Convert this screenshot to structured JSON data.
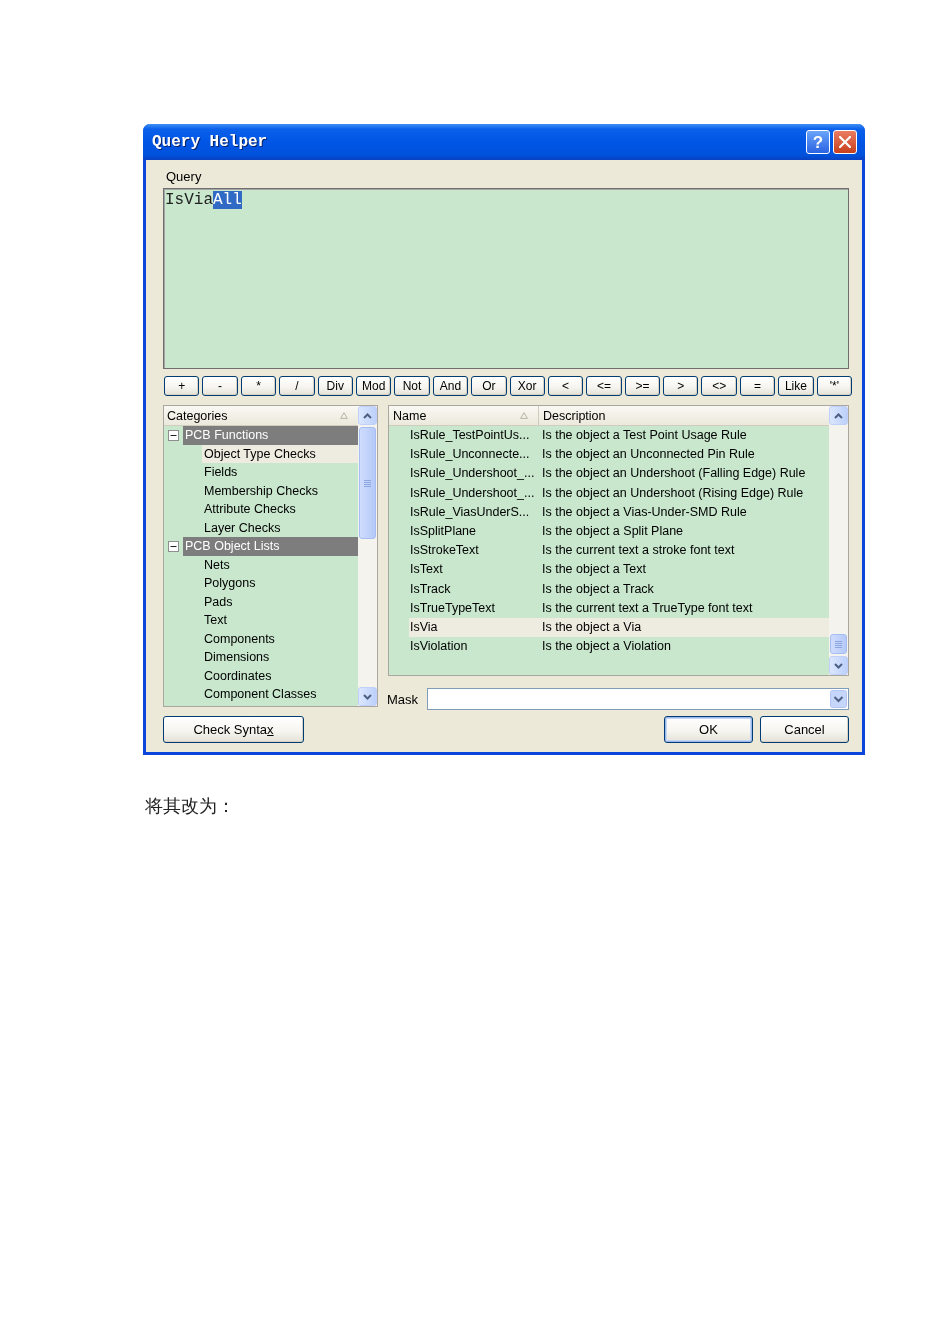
{
  "window": {
    "title": "Query Helper",
    "help_button": "?"
  },
  "query": {
    "label": "Query",
    "value_parts": [
      {
        "text": "IsVia",
        "selected": false
      },
      {
        "text": "All",
        "selected": true
      }
    ]
  },
  "operators": [
    "+",
    "-",
    "*",
    "/",
    "Div",
    "Mod",
    "Not",
    "And",
    "Or",
    "Xor",
    "<",
    "<=",
    ">=",
    ">",
    "<>",
    "=",
    "Like",
    "'*'"
  ],
  "categories": {
    "header": {
      "label": "Categories",
      "sorted": true
    },
    "items": [
      {
        "label": "PCB Functions",
        "expanded": true,
        "children": [
          {
            "label": "Object Type Checks",
            "selected": true
          },
          {
            "label": "Fields",
            "selected": false
          },
          {
            "label": "Membership Checks",
            "selected": false
          },
          {
            "label": "Attribute Checks",
            "selected": false
          },
          {
            "label": "Layer Checks",
            "selected": false
          }
        ]
      },
      {
        "label": "PCB Object Lists",
        "expanded": true,
        "children": [
          {
            "label": "Nets",
            "selected": false
          },
          {
            "label": "Polygons",
            "selected": false
          },
          {
            "label": "Pads",
            "selected": false
          },
          {
            "label": "Text",
            "selected": false
          },
          {
            "label": "Components",
            "selected": false
          },
          {
            "label": "Dimensions",
            "selected": false
          },
          {
            "label": "Coordinates",
            "selected": false
          },
          {
            "label": "Component Classes",
            "selected": false
          }
        ]
      }
    ]
  },
  "functions": {
    "columns": [
      {
        "label": "Name",
        "sorted": true
      },
      {
        "label": "Description",
        "sorted": false
      }
    ],
    "rows": [
      {
        "name": "IsRule_TestPointUs...",
        "description": "Is the object a Test Point Usage Rule",
        "selected": false
      },
      {
        "name": "IsRule_Unconnecte...",
        "description": "Is the object an Unconnected Pin Rule",
        "selected": false
      },
      {
        "name": "IsRule_Undershoot_...",
        "description": "Is the object an Undershoot (Falling Edge) Rule",
        "selected": false
      },
      {
        "name": "IsRule_Undershoot_...",
        "description": "Is the object an Undershoot (Rising Edge) Rule",
        "selected": false
      },
      {
        "name": "IsRule_ViasUnderS...",
        "description": "Is the object a Vias-Under-SMD Rule",
        "selected": false
      },
      {
        "name": "IsSplitPlane",
        "description": "Is the object a Split Plane",
        "selected": false
      },
      {
        "name": "IsStrokeText",
        "description": "Is the current text a stroke font text",
        "selected": false
      },
      {
        "name": "IsText",
        "description": "Is the object a Text",
        "selected": false
      },
      {
        "name": "IsTrack",
        "description": "Is the object a Track",
        "selected": false
      },
      {
        "name": "IsTrueTypeText",
        "description": "Is the current text a TrueType font text",
        "selected": false
      },
      {
        "name": "IsVia",
        "description": "Is the object a Via",
        "selected": true
      },
      {
        "name": "IsViolation",
        "description": "Is the object a Violation",
        "selected": false
      }
    ]
  },
  "mask": {
    "label": "Mask"
  },
  "check_syntax_button": {
    "label": "Check Synta",
    "access_key": "x"
  },
  "dialog_buttons": [
    {
      "label": "OK",
      "default": true
    },
    {
      "label": "Cancel",
      "default": false
    }
  ],
  "caption": "将其改为："
}
